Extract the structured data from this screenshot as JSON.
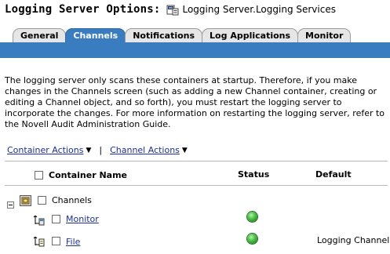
{
  "header": {
    "title": "Logging Server Options:",
    "object_icon": "server-icon",
    "object_name": "Logging Server.Logging Services"
  },
  "tabs": [
    {
      "label": "General",
      "active": false
    },
    {
      "label": "Channels",
      "active": true
    },
    {
      "label": "Notifications",
      "active": false
    },
    {
      "label": "Log Applications",
      "active": false
    },
    {
      "label": "Monitor",
      "active": false
    }
  ],
  "description": "The logging server only scans these containers at startup. Therefore, if you make changes in the Channels screen (such as adding a new Channel container, creating or editing a Channel object, and so forth), you must restart the logging server to incorporate the changes. For more information on restarting the logging server, refer to the Novell Audit Administration Guide.",
  "actions": {
    "container_actions": "Container Actions",
    "separator": "|",
    "channel_actions": "Channel Actions"
  },
  "table": {
    "col_name": "Container Name",
    "col_status": "Status",
    "col_default": "Default",
    "container": {
      "name": "Channels",
      "icon": "container-icon",
      "expand_icon": "collapse-minus-icon"
    },
    "rows": [
      {
        "name": "Monitor",
        "status": "green",
        "default": ""
      },
      {
        "name": "File",
        "status": "green",
        "default": "Logging Channel"
      }
    ]
  },
  "colors": {
    "accent": "#3a7cc0",
    "link": "#1a2f9a",
    "status_ok": "#4fc34a"
  }
}
